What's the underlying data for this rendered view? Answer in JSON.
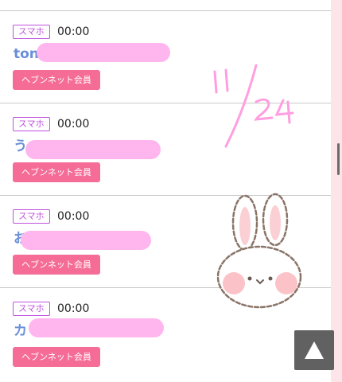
{
  "rows": [
    {
      "device": "スマホ",
      "time": "00:00",
      "name": "ton",
      "member": "ヘブンネット会員"
    },
    {
      "device": "スマホ",
      "time": "00:00",
      "name": "う",
      "member": "ヘブンネット会員"
    },
    {
      "device": "スマホ",
      "time": "00:00",
      "name": "お",
      "member": "ヘブンネット会員"
    },
    {
      "device": "スマホ",
      "time": "00:00",
      "name": "カ",
      "member": "ヘブンネット会員"
    }
  ],
  "overlay": {
    "date": "11/24",
    "sticker_icon": "bunny-sticker"
  },
  "scroll_top_icon": "arrow-up-icon",
  "colors": {
    "device_badge": "#c052e0",
    "member_button": "#f56c97",
    "name_text": "#6a8fd8",
    "scribble": "#ffb6ee"
  }
}
